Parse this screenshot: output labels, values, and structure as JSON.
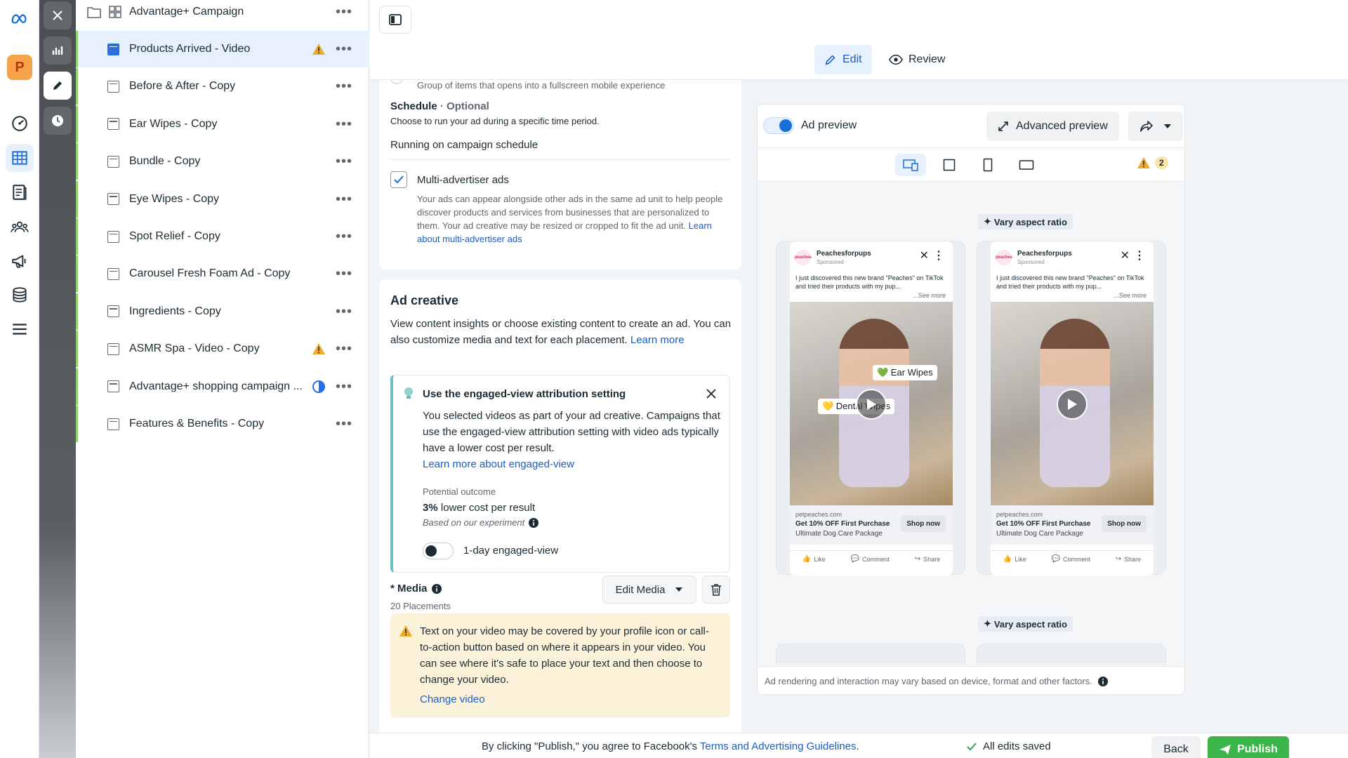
{
  "campaign_tree": {
    "root": {
      "label": "Advantage+ Campaign"
    },
    "ads": [
      {
        "label": "Products Arrived - Video",
        "status": "warning",
        "selected": true
      },
      {
        "label": "Before & After - Copy",
        "status": ""
      },
      {
        "label": "Ear Wipes - Copy",
        "status": ""
      },
      {
        "label": "Bundle - Copy",
        "status": ""
      },
      {
        "label": "Eye Wipes - Copy",
        "status": ""
      },
      {
        "label": "Spot Relief - Copy",
        "status": ""
      },
      {
        "label": "Carousel Fresh Foam Ad - Copy",
        "status": ""
      },
      {
        "label": "Ingredients - Copy",
        "status": ""
      },
      {
        "label": "ASMR Spa - Video - Copy",
        "status": "warning"
      },
      {
        "label": "Advantage+ shopping campaign ...",
        "status": "partial"
      },
      {
        "label": "Features & Benefits - Copy",
        "status": ""
      }
    ],
    "more_glyph": "•••"
  },
  "global_nav": {
    "avatar_letter": "P"
  },
  "header": {
    "edit_label": "Edit",
    "review_label": "Review"
  },
  "form": {
    "format_hint": "Group of items that opens into a fullscreen mobile experience",
    "schedule": {
      "title": "Schedule",
      "optional": "· Optional",
      "description": "Choose to run your ad during a specific time period.",
      "value": "Running on campaign schedule"
    },
    "multi_advertiser": {
      "label": "Multi-advertiser ads",
      "description": "Your ads can appear alongside other ads in the same ad unit to help people discover products and services from businesses that are personalized to them. Your ad creative may be resized or cropped to fit the ad unit.",
      "link": "Learn about multi-advertiser ads",
      "checked": true
    },
    "ad_creative": {
      "title": "Ad creative",
      "description": "View content insights or choose existing content to create an ad. You can also customize media and text for each placement.",
      "learn_more": "Learn more"
    },
    "engaged_view": {
      "title": "Use the engaged-view attribution setting",
      "body": "You selected videos as part of your ad creative. Campaigns that use the engaged-view attribution setting with video ads typically have a lower cost per result.",
      "link": "Learn more about engaged-view",
      "potential_label": "Potential outcome",
      "outcome_bold": "3%",
      "outcome_rest": " lower cost per result",
      "based_on": "Based on our experiment",
      "toggle_label": "1-day engaged-view",
      "toggle_on": false
    },
    "media": {
      "title": "* Media",
      "placements": "20 Placements",
      "edit_button": "Edit Media",
      "warning_text": "Text on your video may be covered by your profile icon or call-to-action button based on where it appears in your video. You can see where it's safe to place your text and then choose to change your video.",
      "change_link": "Change video"
    }
  },
  "preview": {
    "toggle_label": "Ad preview",
    "toggle_on": true,
    "advanced_button": "Advanced preview",
    "warning_count": "2",
    "vary_label": "Vary aspect ratio",
    "footer_note": "Ad rendering and interaction may vary based on device, format and other factors.",
    "ads": [
      {
        "page_name": "Peachesforpups",
        "sponsored": "Sponsored · ",
        "logo_text": "peaches",
        "primary_text": "I just discovered this new brand \"Peaches\" on TikTok and tried their products with my pup...",
        "see_more": "...See more",
        "stickers": [
          "💚 Ear Wipes",
          "💛 Dental Wipes"
        ],
        "domain": "petpeaches.com",
        "headline": "Get 10% OFF First Purchase",
        "description": "Ultimate Dog Care Package",
        "cta": "Shop now",
        "actions": [
          "Like",
          "Comment",
          "Share"
        ]
      },
      {
        "page_name": "Peachesforpups",
        "sponsored": "Sponsored · ",
        "logo_text": "peaches",
        "primary_text": "I just discovered this new brand \"Peaches\" on TikTok and tried their products with my pup...",
        "see_more": "...See more",
        "stickers": [],
        "domain": "petpeaches.com",
        "headline": "Get 10% OFF First Purchase",
        "description": "Ultimate Dog Care Package",
        "cta": "Shop now",
        "actions": [
          "Like",
          "Comment",
          "Share"
        ]
      }
    ]
  },
  "bottom_bar": {
    "agreement_prefix": "By clicking \"Publish,\" you agree to Facebook's ",
    "agreement_link": "Terms and Advertising Guidelines",
    "agreement_suffix": ".",
    "saved_status": "All edits saved",
    "back_button": "Back",
    "publish_button": "Publish"
  },
  "colors": {
    "accent": "#1a6ed8",
    "publish_green": "#3bb54a",
    "warning": "#f0a929",
    "child_rail": "#8fd16b"
  }
}
